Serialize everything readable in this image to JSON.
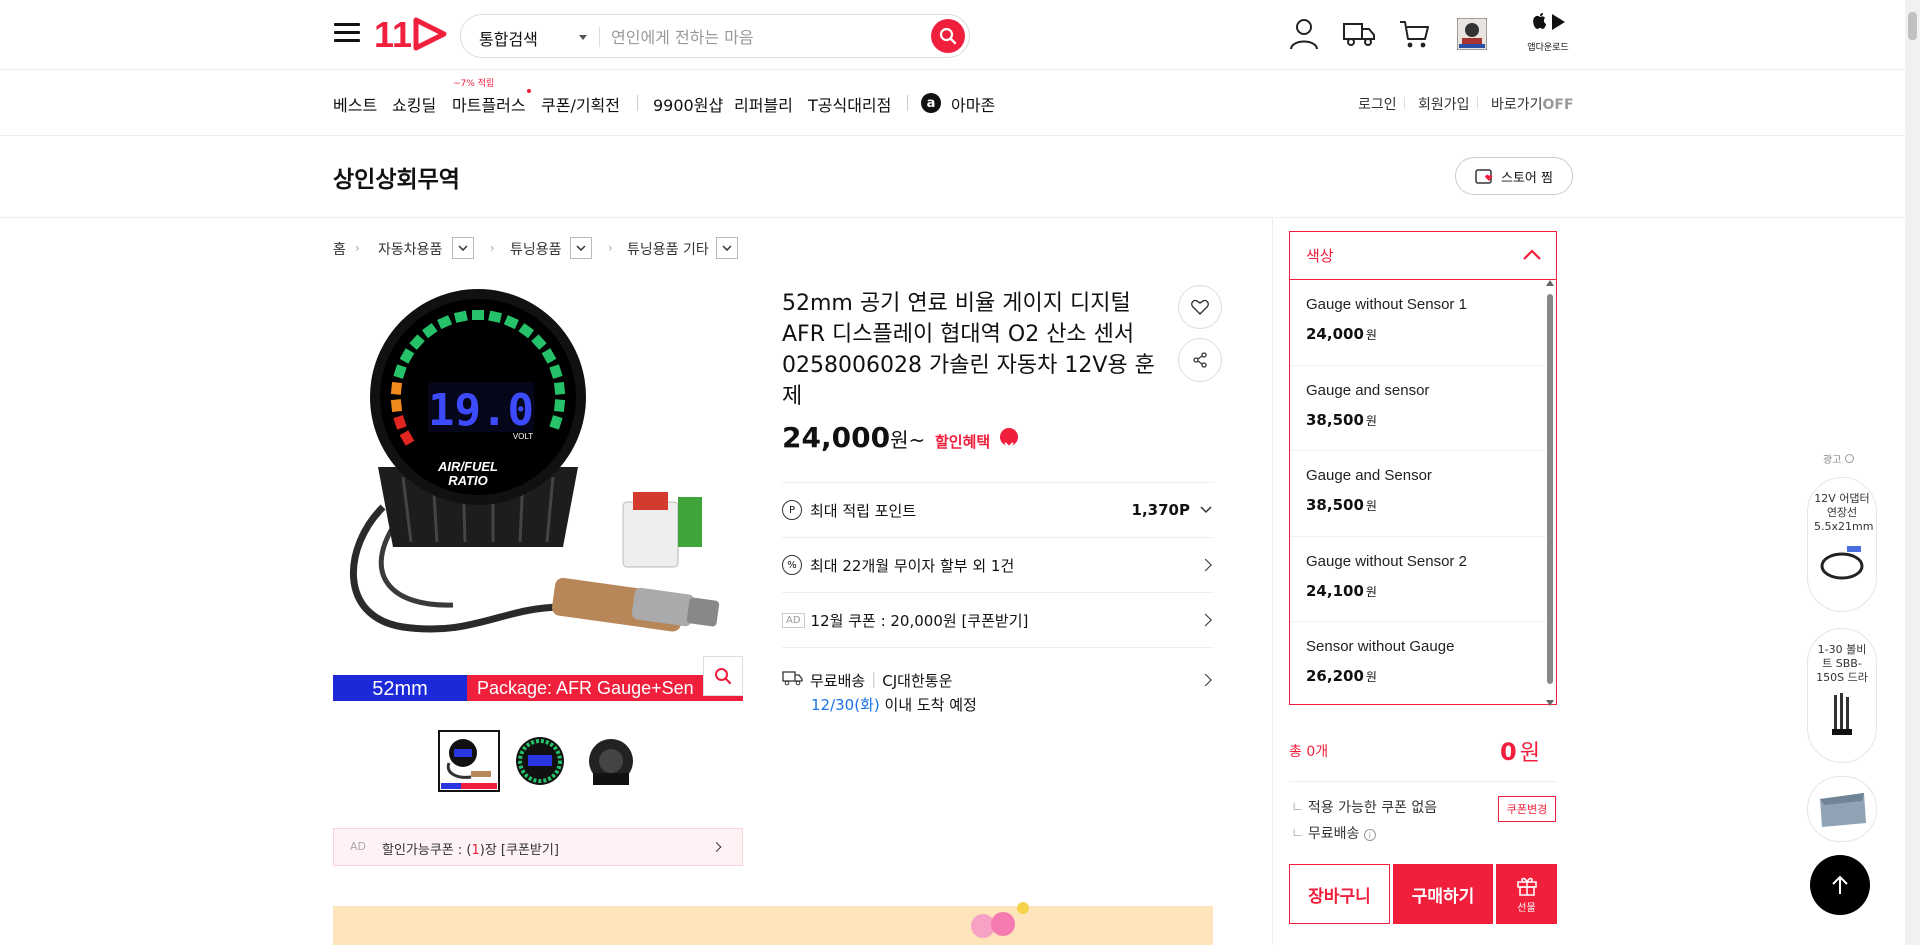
{
  "header": {
    "logo_text": "11",
    "search_type": "통합검색",
    "search_placeholder": "연인에게 전하는 마음",
    "app_download_label": "앱다운로드"
  },
  "nav": {
    "items": [
      "베스트",
      "쇼킹딜",
      "마트플러스",
      "쿠폰/기획전",
      "9900원샵",
      "리퍼블리",
      "T공식대리점",
      "아마존"
    ],
    "mart_badge": "~7% 적립",
    "right_items": [
      "로그인",
      "회원가입",
      "바로가기"
    ],
    "shortcut_state": "OFF"
  },
  "store": {
    "name": "상인상회무역",
    "fav_label": "스토어 찜"
  },
  "breadcrumb": [
    "홈",
    "자동차용품",
    "튜닝용품",
    "튜닝용품 기타"
  ],
  "image": {
    "gauge_value": "19.0",
    "gauge_unit": "VOLT",
    "gauge_label_1": "AIR/FUEL",
    "gauge_label_2": "RATIO",
    "banner_left": "52mm",
    "banner_right": "Package: AFR Gauge+Sen"
  },
  "coupon_bar": {
    "ad": "AD",
    "text_prefix": "할인가능쿠폰 : (",
    "count": "1",
    "text_suffix": ")장 [쿠폰받기]"
  },
  "product": {
    "title": "52mm 공기 연료 비율 게이지 디지털 AFR 디스플레이 협대역 O2 산소 센서 0258006028 가솔린 자동차 12V용 훈제",
    "price": "24,000",
    "price_unit": "원~",
    "discount_label": "할인혜택",
    "point_label": "최대 적립 포인트",
    "point_value": "1,370P",
    "installment": "최대 22개월 무이자 할부 외 1건",
    "ad_badge": "AD",
    "coupon_text": "12월 쿠폰 : 20,000원 [쿠폰받기]",
    "shipping_label": "무료배송",
    "courier": "CJ대한통운",
    "arrival_date": "12/30(화)",
    "arrival_text": "이내 도착 예정"
  },
  "options": {
    "header": "색상",
    "items": [
      {
        "name": "Gauge without Sensor 1",
        "price": "24,000",
        "unit": "원"
      },
      {
        "name": "Gauge and sensor",
        "price": "38,500",
        "unit": "원"
      },
      {
        "name": "Gauge and Sensor",
        "price": "38,500",
        "unit": "원"
      },
      {
        "name": "Gauge without Sensor 2",
        "price": "24,100",
        "unit": "원"
      },
      {
        "name": "Sensor without Gauge",
        "price": "26,200",
        "unit": "원"
      }
    ]
  },
  "order": {
    "total_label": "총 0개",
    "total_value": "0",
    "total_unit": "원",
    "coupon_none": "적용 가능한 쿠폰 없음",
    "free_shipping": "무료배송",
    "coupon_change": "쿠폰변경",
    "cart_label": "장바구니",
    "buy_label": "구매하기",
    "gift_label": "선물"
  },
  "ads": {
    "label": "광고",
    "card1": "12V 어댑터 연장선 5.5x21mm",
    "card2": "1-30 볼비트 SBB-150S 드라"
  },
  "colors": {
    "accent": "#f01f3c",
    "link_blue": "#1a73e8"
  }
}
